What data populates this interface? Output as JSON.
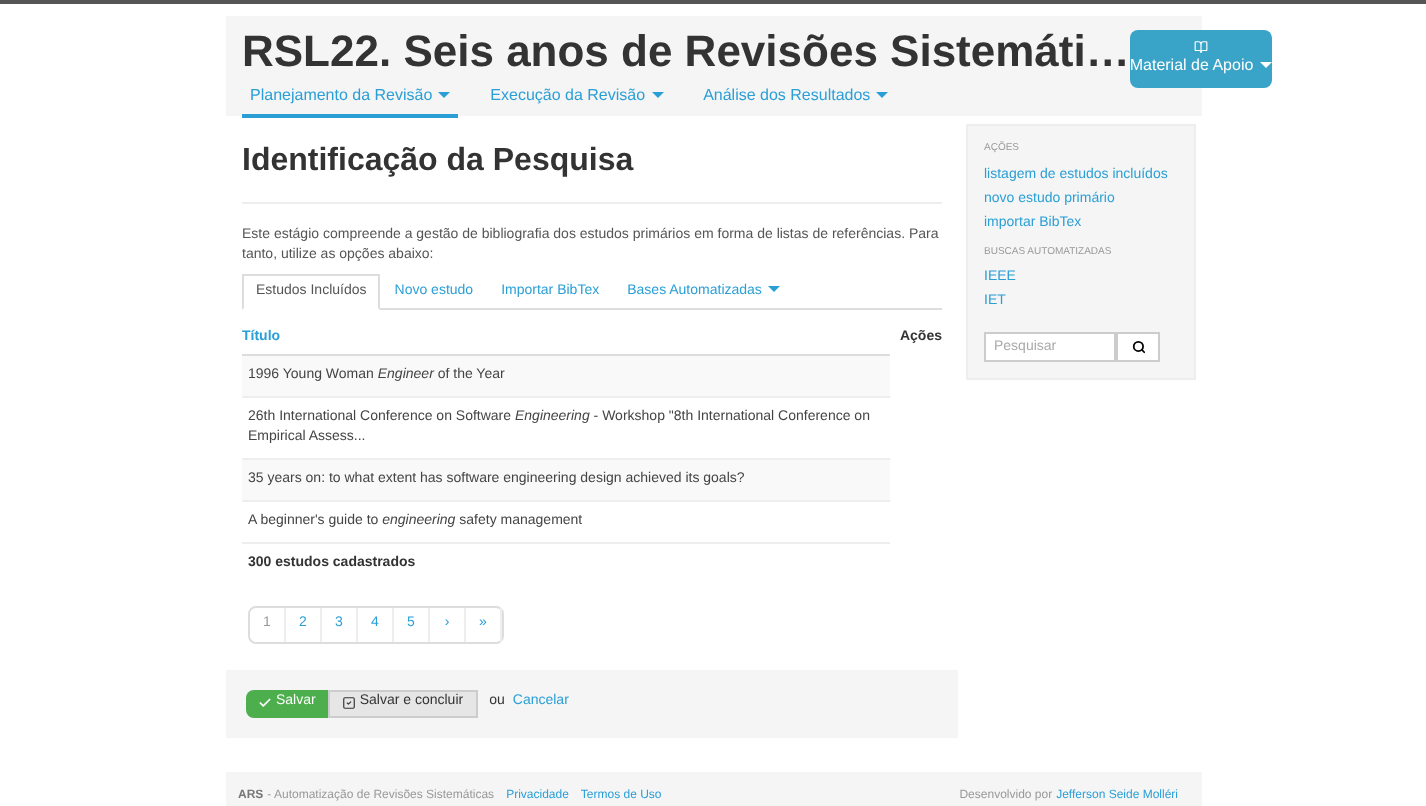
{
  "header": {
    "title": "RSL22. Seis anos de Revisões Sistemáti…",
    "nav": [
      {
        "label": "Planejamento da Revisão",
        "selected": true
      },
      {
        "label": "Execução da Revisão",
        "selected": false
      },
      {
        "label": "Análise dos Resultados",
        "selected": false
      }
    ],
    "support_button": "Material de Apoio"
  },
  "page_title": "Identificação da Pesquisa",
  "description": "Este estágio compreende a gestão de bibliografia dos estudos primários em forma de listas de referências. Para tanto, utilize as opções abaixo:",
  "tabs": [
    {
      "label": "Estudos Incluídos",
      "selected": true,
      "dropdown": false
    },
    {
      "label": "Novo estudo",
      "selected": false,
      "dropdown": false
    },
    {
      "label": "Importar BibTex",
      "selected": false,
      "dropdown": false
    },
    {
      "label": "Bases Automatizadas",
      "selected": false,
      "dropdown": true
    }
  ],
  "table": {
    "columns": [
      "Título",
      "Ações"
    ],
    "rows": [
      {
        "title": "1996 Young Woman *Engineer* of the Year"
      },
      {
        "title": "26th International Conference on Software *Engineering* - Workshop \"8th International Conference on Empirical Assess..."
      },
      {
        "title": "35 years on: to what extent has software engineering design achieved its goals?"
      },
      {
        "title": "A beginner's guide to *engineering* safety management"
      }
    ],
    "total": "300 estudos cadastrados"
  },
  "pagination": [
    {
      "label": "1",
      "selected": true
    },
    {
      "label": "2",
      "selected": false
    },
    {
      "label": "3",
      "selected": false
    },
    {
      "label": "4",
      "selected": false
    },
    {
      "label": "5",
      "selected": false
    },
    {
      "label": "›",
      "selected": false
    },
    {
      "label": "»",
      "selected": false
    }
  ],
  "form_actions": {
    "save": "Salvar",
    "save_conclude": "Salvar e concluir",
    "or": "ou",
    "cancel": "Cancelar"
  },
  "sidebar": {
    "sections": [
      {
        "heading": "AÇÕES",
        "links": [
          "listagem de estudos incluídos",
          "novo estudo primário",
          "importar BibTex"
        ]
      },
      {
        "heading": "BUSCAS AUTOMATIZADAS",
        "links": [
          "IEEE",
          "IET"
        ]
      }
    ],
    "search": {
      "placeholder": "Pesquisar"
    }
  },
  "footer": {
    "brand": "ARS",
    "tagline": "- Automatização de Revisões Sistemáticas",
    "links": [
      "Privacidade",
      "Termos de Uso"
    ],
    "credit": "Desenvolvido por",
    "author": "Jefferson Seide Molléri"
  }
}
